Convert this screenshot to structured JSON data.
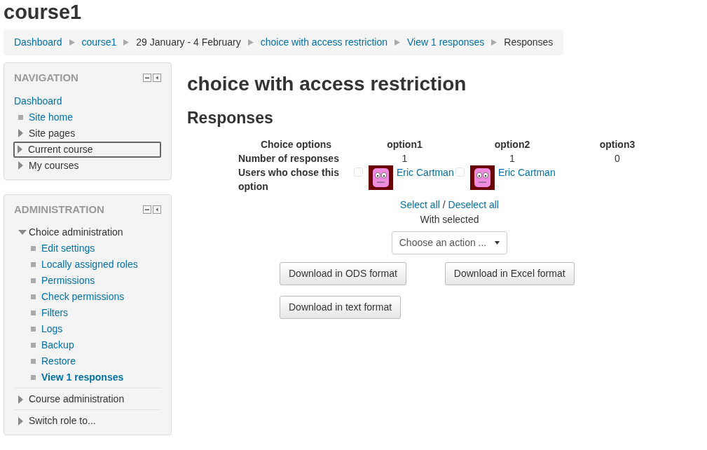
{
  "page_title": "course1",
  "breadcrumb": [
    {
      "label": "Dashboard",
      "kind": "link"
    },
    {
      "label": "course1",
      "kind": "link"
    },
    {
      "label": "29 January - 4 February",
      "kind": "text"
    },
    {
      "label": "choice with access restriction",
      "kind": "link"
    },
    {
      "label": "View 1 responses",
      "kind": "link"
    },
    {
      "label": "Responses",
      "kind": "text"
    }
  ],
  "navigation": {
    "title": "NAVIGATION",
    "items": [
      {
        "label": "Dashboard",
        "kind": "root",
        "selected": false
      },
      {
        "label": "Site home",
        "kind": "leaf",
        "selected": false
      },
      {
        "label": "Site pages",
        "kind": "branch",
        "expanded": false,
        "selected": false
      },
      {
        "label": "Current course",
        "kind": "branch",
        "expanded": false,
        "selected": true
      },
      {
        "label": "My courses",
        "kind": "branch",
        "expanded": false,
        "selected": false
      }
    ]
  },
  "administration": {
    "title": "ADMINISTRATION",
    "items": [
      {
        "label": "Choice administration",
        "kind": "branch",
        "expanded": true,
        "children": [
          {
            "label": "Edit settings",
            "selected": false
          },
          {
            "label": "Locally assigned roles",
            "selected": false
          },
          {
            "label": "Permissions",
            "selected": false
          },
          {
            "label": "Check permissions",
            "selected": false
          },
          {
            "label": "Filters",
            "selected": false
          },
          {
            "label": "Logs",
            "selected": false
          },
          {
            "label": "Backup",
            "selected": false
          },
          {
            "label": "Restore",
            "selected": false
          },
          {
            "label": "View 1 responses",
            "selected": true
          }
        ]
      },
      {
        "label": "Course administration",
        "kind": "branch",
        "expanded": false
      },
      {
        "label": "Switch role to...",
        "kind": "branch",
        "expanded": false
      }
    ]
  },
  "heading": "choice with access restriction",
  "subheading": "Responses",
  "responses": {
    "row_labels": [
      "Choice options",
      "Number of responses",
      "Users who chose this option"
    ],
    "options": [
      {
        "name": "option1",
        "count": "1",
        "users": [
          {
            "name": "Eric Cartman",
            "checked": false
          }
        ]
      },
      {
        "name": "option2",
        "count": "1",
        "users": [
          {
            "name": "Eric Cartman",
            "checked": false
          }
        ]
      },
      {
        "name": "option3",
        "count": "0"
      }
    ]
  },
  "select_all": "Select all",
  "separator": "/",
  "deselect_all": "Deselect all",
  "with_selected": "With selected",
  "action_select": "Choose an action ...",
  "buttons": [
    "Download in ODS format",
    "Download in Excel format",
    "Download in text format"
  ]
}
